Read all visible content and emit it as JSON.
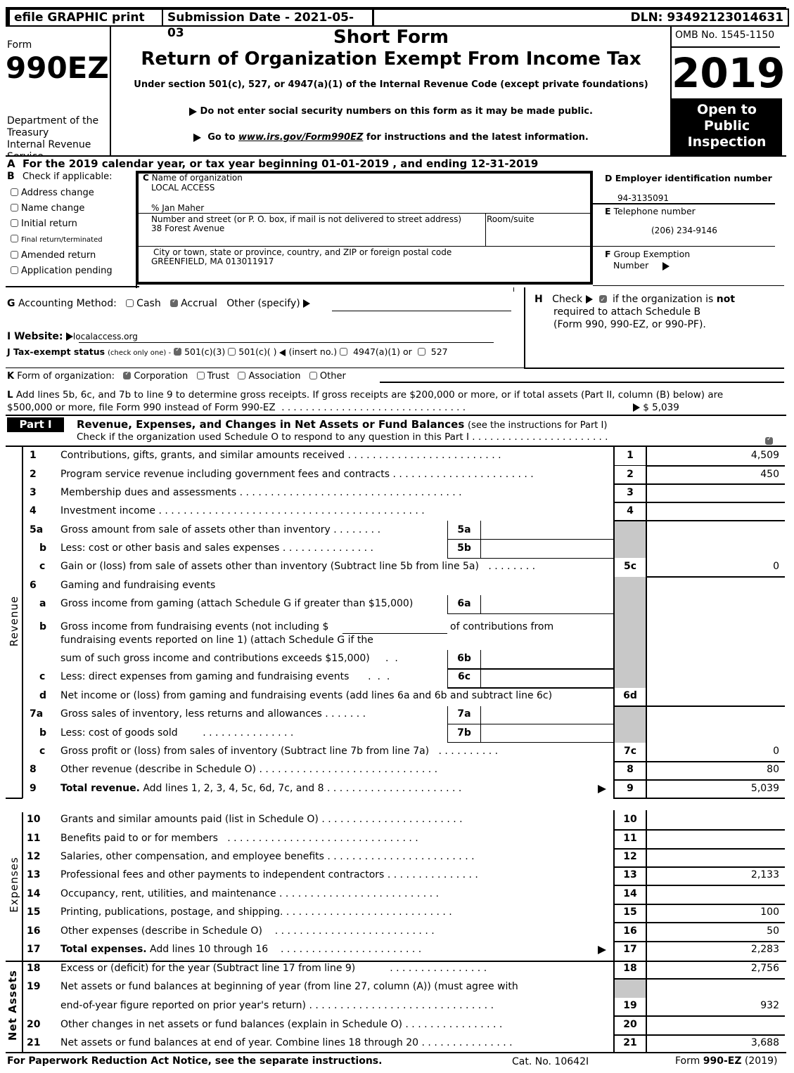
{
  "banner": {
    "efile": "efile GRAPHIC print",
    "submission": "Submission Date - 2021-05-03",
    "dln": "DLN: 93492123014631"
  },
  "header": {
    "form_word": "Form",
    "form_number": "990EZ",
    "dept_line1": "Department of the",
    "dept_line2": "Treasury",
    "dept_line3": "Internal Revenue",
    "dept_line4": "Service",
    "title_short": "Short Form",
    "title_main": "Return of Organization Exempt From Income Tax",
    "subtitle": "Under section 501(c), 527, or 4947(a)(1) of the Internal Revenue Code (except private foundations)",
    "notice1": "Do not enter social security numbers on this form as it may be made public.",
    "notice2_pre": "Go to ",
    "notice2_link": "www.irs.gov/Form990EZ",
    "notice2_post": " for instructions and the latest information.",
    "omb": "OMB No. 1545-1150",
    "year": "2019",
    "open_line1": "Open to",
    "open_line2": "Public",
    "open_line3": "Inspection"
  },
  "line_a": {
    "letter": "A",
    "text": "For the 2019 calendar year, or tax year beginning 01-01-2019 , and ending 12-31-2019"
  },
  "section_b": {
    "letter": "B",
    "title": "Check if applicable:",
    "items": [
      {
        "label": "Address change",
        "checked": false
      },
      {
        "label": "Name change",
        "checked": false
      },
      {
        "label": "Initial return",
        "checked": false
      },
      {
        "label": "Final return/terminated",
        "checked": false
      },
      {
        "label": "Amended return",
        "checked": false
      },
      {
        "label": "Application pending",
        "checked": false
      }
    ]
  },
  "section_c": {
    "letter": "C",
    "name_label": "Name of organization",
    "org_name": "LOCAL ACCESS",
    "care_of": "% Jan Maher",
    "street_label": "Number and street (or P. O. box, if mail is not delivered to street address)",
    "street": "38 Forest Avenue",
    "room_label": "Room/suite",
    "room": "",
    "city_label": "City or town, state or province, country, and ZIP or foreign postal code",
    "city": "GREENFIELD, MA  013011917"
  },
  "section_d": {
    "letter": "D",
    "label": "Employer identification number",
    "value": "94-3135091"
  },
  "section_e": {
    "letter": "E",
    "label": "Telephone number",
    "value": "(206) 234-9146"
  },
  "section_f": {
    "letter": "F",
    "label1": "Group Exemption",
    "label2": "Number",
    "value": ""
  },
  "section_g": {
    "letter": "G",
    "label": "Accounting Method:",
    "options": [
      {
        "label": "Cash",
        "checked": false
      },
      {
        "label": "Accrual",
        "checked": true
      }
    ],
    "other_label": "Other (specify)",
    "other_value": ""
  },
  "section_h": {
    "letter": "H",
    "pre": "Check",
    "checked": true,
    "text1": "if the organization is ",
    "text_bold": "not",
    "line2": "required to attach Schedule B",
    "line3": "(Form 990, 990-EZ, or 990-PF)."
  },
  "section_i": {
    "label": "I Website:",
    "value": "localaccess.org"
  },
  "section_j": {
    "label": "J Tax-exempt status",
    "note": "(check only one) -",
    "options": [
      {
        "label": "501(c)(3)",
        "checked": true
      },
      {
        "label": "501(c)(   )",
        "checked": false
      },
      {
        "label": "(insert no.)",
        "checked": false
      },
      {
        "label": "4947(a)(1) or",
        "checked": false
      },
      {
        "label": "527",
        "checked": false
      }
    ]
  },
  "section_k": {
    "letter": "K",
    "label": "Form of organization:",
    "options": [
      {
        "label": "Corporation",
        "checked": true
      },
      {
        "label": "Trust",
        "checked": false
      },
      {
        "label": "Association",
        "checked": false
      },
      {
        "label": "Other",
        "checked": false
      }
    ]
  },
  "section_l": {
    "letter": "L",
    "line1": "Add lines 5b, 6c, and 7b to line 9 to determine gross receipts. If gross receipts are $200,000 or more, or if total assets (Part II, column (B) below) are",
    "line2": "$500,000 or more, file Form 990 instead of Form 990-EZ",
    "amount": "$ 5,039"
  },
  "part1": {
    "badge": "Part I",
    "title": "Revenue, Expenses, and Changes in Net Assets or Fund Balances",
    "title_note": "(see the instructions for Part I)",
    "schedule_o_text": "Check if the organization used Schedule O to respond to any question in this Part I",
    "schedule_o_checked": true,
    "side_revenue": "Revenue",
    "side_expenses": "Expenses",
    "side_net_assets": "Net Assets",
    "lines": {
      "l1": {
        "num": "1",
        "text": "Contributions, gifts, grants, and similar amounts received",
        "box": "1",
        "amount": "4,509"
      },
      "l2": {
        "num": "2",
        "text": "Program service revenue including government fees and contracts",
        "box": "2",
        "amount": "450"
      },
      "l3": {
        "num": "3",
        "text": "Membership dues and assessments",
        "box": "3",
        "amount": ""
      },
      "l4": {
        "num": "4",
        "text": "Investment income",
        "box": "4",
        "amount": ""
      },
      "l5a": {
        "num": "5a",
        "text": "Gross amount from sale of assets other than inventory",
        "box": "5a",
        "amount": ""
      },
      "l5b": {
        "num": "b",
        "text": "Less: cost or other basis and sales expenses",
        "box": "5b",
        "amount": ""
      },
      "l5c": {
        "num": "c",
        "text": "Gain or (loss) from sale of assets other than inventory (Subtract line 5b from line 5a)",
        "box": "5c",
        "amount": "0"
      },
      "l6": {
        "num": "6",
        "text": "Gaming and fundraising events"
      },
      "l6a": {
        "num": "a",
        "text": "Gross income from gaming (attach Schedule G if greater than $15,000)",
        "box": "6a",
        "amount": ""
      },
      "l6b": {
        "num": "b",
        "text1": "Gross income from fundraising events (not including $",
        "text1b": "of contributions from",
        "text2": "fundraising events reported on line 1) (attach Schedule G if the",
        "text3": "sum of such gross income and contributions exceeds $15,000)",
        "box": "6b",
        "amount": ""
      },
      "l6c": {
        "num": "c",
        "text": "Less: direct expenses from gaming and fundraising events",
        "box": "6c",
        "amount": ""
      },
      "l6d": {
        "num": "d",
        "text": "Net income or (loss) from gaming and fundraising events (add lines 6a and 6b and subtract line 6c)",
        "box": "6d",
        "amount": ""
      },
      "l7a": {
        "num": "7a",
        "text": "Gross sales of inventory, less returns and allowances",
        "box": "7a",
        "amount": ""
      },
      "l7b": {
        "num": "b",
        "text": "Less: cost of goods sold",
        "box": "7b",
        "amount": ""
      },
      "l7c": {
        "num": "c",
        "text": "Gross profit or (loss) from sales of inventory (Subtract line 7b from line 7a)",
        "box": "7c",
        "amount": "0"
      },
      "l8": {
        "num": "8",
        "text": "Other revenue (describe in Schedule O)",
        "box": "8",
        "amount": "80"
      },
      "l9": {
        "num": "9",
        "text_bold": "Total revenue.",
        "text": " Add lines 1, 2, 3, 4, 5c, 6d, 7c, and 8",
        "box": "9",
        "amount": "5,039"
      },
      "l10": {
        "num": "10",
        "text": "Grants and similar amounts paid (list in Schedule O)",
        "box": "10",
        "amount": ""
      },
      "l11": {
        "num": "11",
        "text": "Benefits paid to or for members",
        "box": "11",
        "amount": ""
      },
      "l12": {
        "num": "12",
        "text": "Salaries, other compensation, and employee benefits",
        "box": "12",
        "amount": ""
      },
      "l13": {
        "num": "13",
        "text": "Professional fees and other payments to independent contractors",
        "box": "13",
        "amount": "2,133"
      },
      "l14": {
        "num": "14",
        "text": "Occupancy, rent, utilities, and maintenance",
        "box": "14",
        "amount": ""
      },
      "l15": {
        "num": "15",
        "text": "Printing, publications, postage, and shipping.",
        "box": "15",
        "amount": "100"
      },
      "l16": {
        "num": "16",
        "text": "Other expenses (describe in Schedule O)",
        "box": "16",
        "amount": "50"
      },
      "l17": {
        "num": "17",
        "text_bold": "Total expenses.",
        "text": " Add lines 10 through 16",
        "box": "17",
        "amount": "2,283"
      },
      "l18": {
        "num": "18",
        "text": "Excess or (deficit) for the year (Subtract line 17 from line 9)",
        "box": "18",
        "amount": "2,756"
      },
      "l19": {
        "num": "19",
        "text1": "Net assets or fund balances at beginning of year (from line 27, column (A)) (must agree with",
        "text2": "end-of-year figure reported on prior year's return)",
        "box": "19",
        "amount": "932"
      },
      "l20": {
        "num": "20",
        "text": "Other changes in net assets or fund balances (explain in Schedule O)",
        "box": "20",
        "amount": ""
      },
      "l21": {
        "num": "21",
        "text": "Net assets or fund balances at end of year. Combine lines 18 through 20",
        "box": "21",
        "amount": "3,688"
      }
    }
  },
  "footer": {
    "paperwork": "For Paperwork Reduction Act Notice, see the separate instructions.",
    "cat_no": "Cat. No. 10642I",
    "form_pre": "Form ",
    "form_bold": "990-EZ",
    "form_year": " (2019)"
  }
}
